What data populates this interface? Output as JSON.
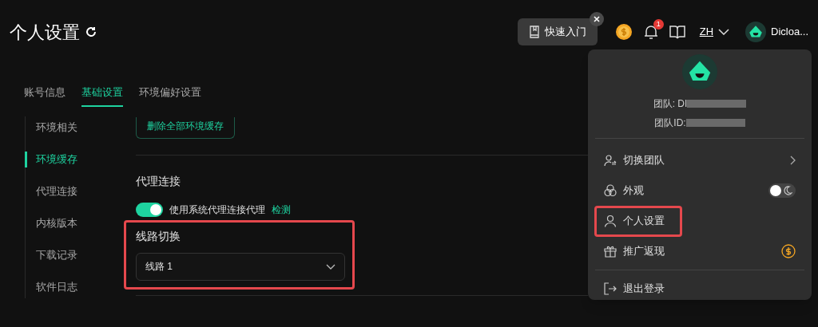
{
  "page": {
    "title": "个人设置"
  },
  "header": {
    "quick_start": "快速入门",
    "notification_badge": "1",
    "language": "ZH",
    "user": "Dicloa..."
  },
  "tabs": [
    {
      "label": "账号信息",
      "selected": false
    },
    {
      "label": "基础设置",
      "selected": true
    },
    {
      "label": "环境偏好设置",
      "selected": false
    }
  ],
  "sidebar": {
    "items": [
      {
        "label": "环境相关",
        "selected": false
      },
      {
        "label": "环境缓存",
        "selected": true
      },
      {
        "label": "代理连接",
        "selected": false
      },
      {
        "label": "内核版本",
        "selected": false
      },
      {
        "label": "下载记录",
        "selected": false
      },
      {
        "label": "软件日志",
        "selected": false
      }
    ]
  },
  "cache": {
    "button": "删除全部环境缓存"
  },
  "proxy": {
    "heading": "代理连接",
    "toggle_on": true,
    "toggle_label": "使用系统代理连接代理",
    "link": "检测"
  },
  "route": {
    "heading": "线路切换",
    "highlighted": true,
    "select_value": "线路 1"
  },
  "user_menu": {
    "team": "团队: DI",
    "team_id": "团队ID:",
    "items": [
      {
        "kind": "team",
        "label": "切换团队",
        "highlighted": false
      },
      {
        "kind": "appearance",
        "label": "外观",
        "highlighted": false,
        "on": false
      },
      {
        "kind": "settings",
        "label": "个人设置",
        "highlighted": true
      },
      {
        "kind": "referral",
        "label": "推广返现",
        "highlighted": false
      },
      {
        "kind": "logout",
        "label": "退出登录",
        "highlighted": false
      }
    ]
  }
}
